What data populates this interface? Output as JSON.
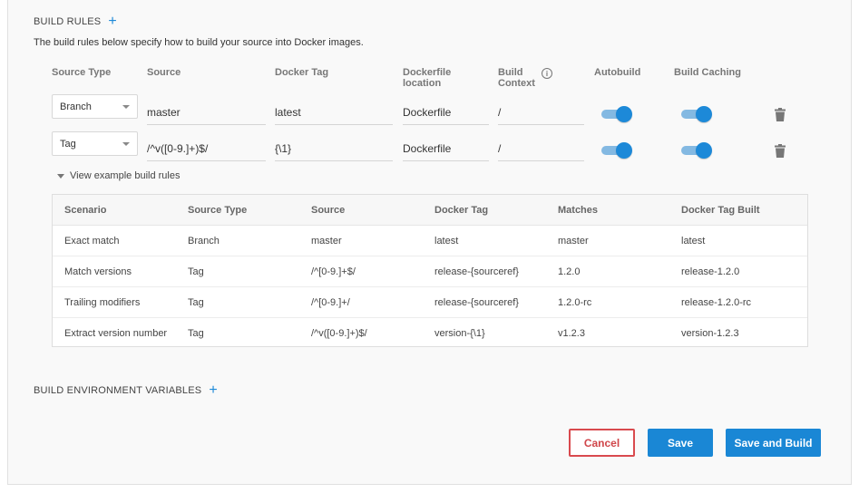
{
  "build_rules": {
    "title": "BUILD RULES",
    "add_symbol": "+",
    "description": "The build rules below specify how to build your source into Docker images.",
    "columns": {
      "source_type": "Source Type",
      "source": "Source",
      "docker_tag": "Docker Tag",
      "dockerfile_l1": "Dockerfile",
      "dockerfile_l2": "location",
      "context_l1": "Build",
      "context_l2": "Context",
      "autobuild": "Autobuild",
      "build_caching": "Build Caching"
    },
    "info_symbol": "i",
    "rules": [
      {
        "source_type": "Branch",
        "source": "master",
        "docker_tag": "latest",
        "dockerfile": "Dockerfile",
        "context": "/",
        "autobuild": true,
        "build_caching": true
      },
      {
        "source_type": "Tag",
        "source": "/^v([0-9.]+)$/",
        "docker_tag": "{\\1}",
        "dockerfile": "Dockerfile",
        "context": "/",
        "autobuild": true,
        "build_caching": true
      }
    ]
  },
  "examples": {
    "toggle_label": "View example build rules",
    "headers": [
      "Scenario",
      "Source Type",
      "Source",
      "Docker Tag",
      "Matches",
      "Docker Tag Built"
    ],
    "rows": [
      [
        "Exact match",
        "Branch",
        "master",
        "latest",
        "master",
        "latest"
      ],
      [
        "Match versions",
        "Tag",
        "/^[0-9.]+$/",
        "release-{sourceref}",
        "1.2.0",
        "release-1.2.0"
      ],
      [
        "Trailing modifiers",
        "Tag",
        "/^[0-9.]+/",
        "release-{sourceref}",
        "1.2.0-rc",
        "release-1.2.0-rc"
      ],
      [
        "Extract version number",
        "Tag",
        "/^v([0-9.]+)$/",
        "version-{\\1}",
        "v1.2.3",
        "version-1.2.3"
      ]
    ]
  },
  "env_vars": {
    "title": "BUILD ENVIRONMENT VARIABLES",
    "add_symbol": "+"
  },
  "buttons": {
    "cancel": "Cancel",
    "save": "Save",
    "save_and_build": "Save and Build"
  },
  "colors": {
    "accent": "#1a87d5",
    "danger": "#d94a4e"
  }
}
